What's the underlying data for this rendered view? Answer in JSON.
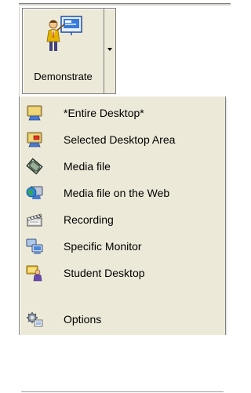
{
  "toolbar": {
    "demonstrate_label": "Demonstrate"
  },
  "menu": {
    "items": [
      {
        "label": "*Entire Desktop*",
        "icon": "monitor-icon"
      },
      {
        "label": "Selected Desktop Area",
        "icon": "monitor-area-icon"
      },
      {
        "label": "Media file",
        "icon": "film-icon"
      },
      {
        "label": "Media file on the Web",
        "icon": "globe-monitor-icon"
      },
      {
        "label": "Recording",
        "icon": "clapperboard-icon"
      },
      {
        "label": "Specific Monitor",
        "icon": "dual-monitor-icon"
      },
      {
        "label": "Student Desktop",
        "icon": "student-monitor-icon"
      }
    ],
    "options_label": "Options",
    "options_icon": "options-gear-icon"
  }
}
